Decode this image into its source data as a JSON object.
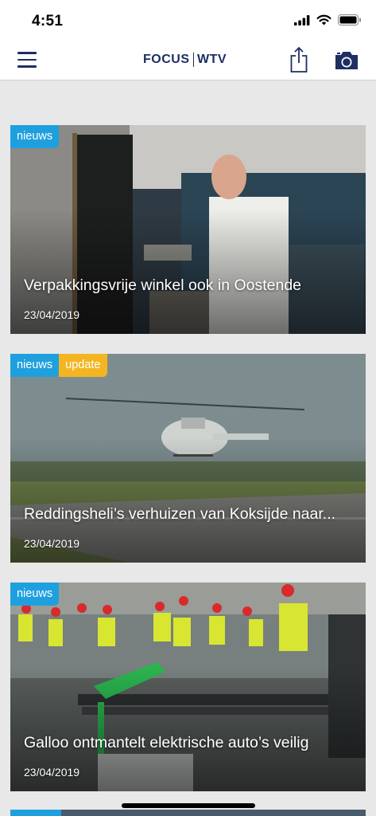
{
  "status": {
    "time": "4:51"
  },
  "nav": {
    "logo_left": "FOCUS",
    "logo_right": "WTV",
    "menu_icon": "hamburger-icon",
    "share_icon": "share-icon",
    "camera_icon": "camera-icon"
  },
  "colors": {
    "news": "#1fa0de",
    "update": "#f3b521",
    "brand": "#1d2f62"
  },
  "articles": [
    {
      "badges": [
        "nieuws"
      ],
      "title": "Verpakkingsvrije winkel ook in Oostende",
      "date": "23/04/2019"
    },
    {
      "badges": [
        "nieuws",
        "update"
      ],
      "title": "Reddingsheli’s verhuizen van Koksijde naar...",
      "date": "23/04/2019"
    },
    {
      "badges": [
        "nieuws"
      ],
      "title": "Galloo ontmantelt elektrische auto’s veilig",
      "date": "23/04/2019"
    }
  ]
}
